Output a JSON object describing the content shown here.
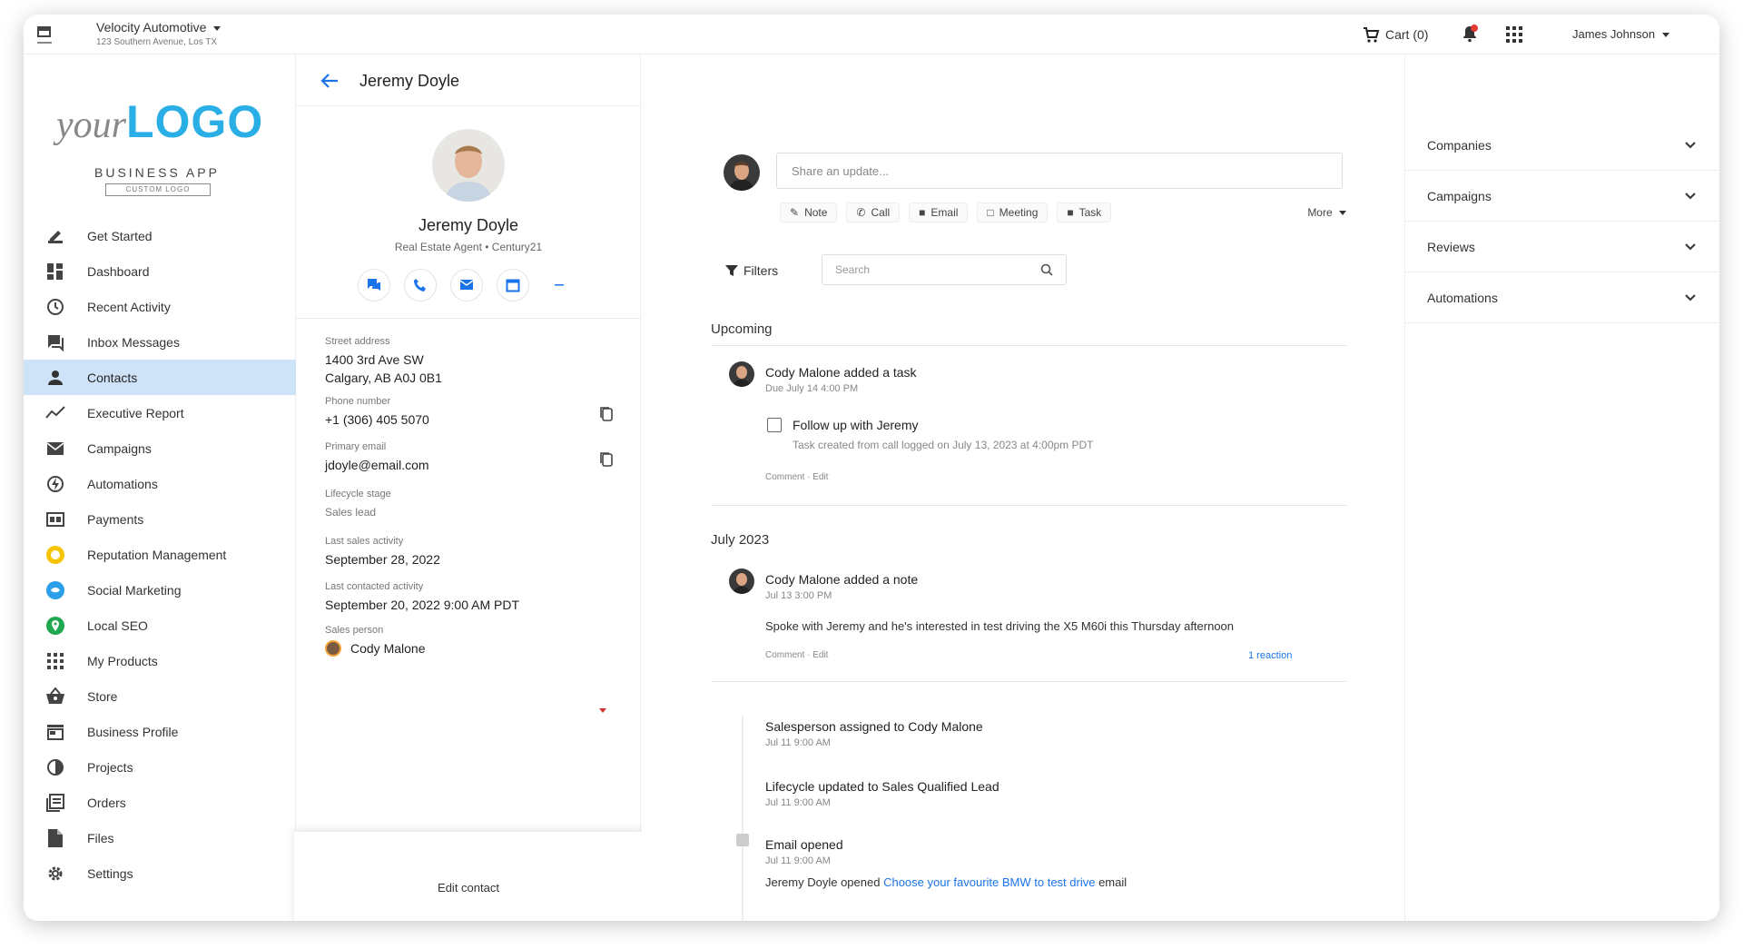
{
  "topbar": {
    "company_name": "Velocity Automotive",
    "company_address": "123 Southern Avenue, Los TX",
    "cart_label": "Cart (0)",
    "user_name": "James Johnson"
  },
  "sidebar": {
    "logo_your": "your",
    "logo_big": "LOGO",
    "business_app": "BUSINESS APP",
    "business_sub": "CUSTOM LOGO",
    "items": [
      {
        "label": "Get Started",
        "icon": "rocket-icon"
      },
      {
        "label": "Dashboard",
        "icon": "dashboard-icon"
      },
      {
        "label": "Recent Activity",
        "icon": "clock-icon"
      },
      {
        "label": "Inbox Messages",
        "icon": "chat-icon"
      },
      {
        "label": "Contacts",
        "icon": "person-icon"
      },
      {
        "label": "Executive Report",
        "icon": "trend-icon"
      },
      {
        "label": "Campaigns",
        "icon": "mail-icon"
      },
      {
        "label": "Automations",
        "icon": "automation-icon"
      },
      {
        "label": "Payments",
        "icon": "payment-icon"
      },
      {
        "label": "Reputation Management",
        "icon": "star-circle-icon"
      },
      {
        "label": "Social Marketing",
        "icon": "social-icon"
      },
      {
        "label": "Local SEO",
        "icon": "pin-icon"
      },
      {
        "label": "My Products",
        "icon": "grid-icon"
      },
      {
        "label": "Store",
        "icon": "basket-icon"
      },
      {
        "label": "Business Profile",
        "icon": "storefront-icon"
      },
      {
        "label": "Projects",
        "icon": "projects-icon"
      },
      {
        "label": "Orders",
        "icon": "orders-icon"
      },
      {
        "label": "Files",
        "icon": "file-icon"
      },
      {
        "label": "Settings",
        "icon": "gear-icon"
      }
    ]
  },
  "contact": {
    "header_name": "Jeremy Doyle",
    "name": "Jeremy Doyle",
    "subtitle": "Real Estate Agent • Century21",
    "fields": {
      "address_label": "Street address",
      "address_line1": "1400 3rd Ave SW",
      "address_line2": "Calgary, AB A0J 0B1",
      "phone_label": "Phone number",
      "phone_value": "+1 (306) 405 5070",
      "email_label": "Primary email",
      "email_value": "jdoyle@email.com",
      "lifecycle_label": "Lifecycle stage",
      "lifecycle_value": "Sales lead",
      "last_activity_label": "Last sales activity",
      "last_activity_value": "September 28, 2022",
      "last_contacted_label": "Last contacted activity",
      "last_contacted_value": "September 20, 2022 9:00 AM PDT",
      "owner_label": "Sales person",
      "owner_value": "Cody Malone"
    },
    "footer_button": "Edit contact"
  },
  "activity": {
    "post_placeholder": "Share an update...",
    "actions": [
      "Note",
      "Call",
      "Email",
      "Meeting",
      "Task"
    ],
    "more_label": "More",
    "filters_label": "Filters",
    "search_placeholder": "Search",
    "upcoming_title": "Upcoming",
    "task_title": "Cody Malone added a task",
    "task_sub": "Due July 14 4:00 PM",
    "task_item": "Follow up with Jeremy",
    "task_desc": "Task created from call logged on July 13, 2023 at 4:00pm PDT",
    "task_comment": "Comment · Edit",
    "month_title": "July 2023",
    "note_title": "Cody Malone added a note",
    "note_sub": "Jul 13 3:00 PM",
    "note_body": "Spoke with Jeremy and he's interested in test driving the X5 M60i this Thursday afternoon",
    "note_comment": "Comment · Edit",
    "note_link": "1 reaction",
    "events": [
      {
        "title": "Salesperson assigned to Cody Malone",
        "sub": "Jul 11 9:00 AM"
      },
      {
        "title": "Lifecycle updated to Sales Qualified Lead",
        "sub": "Jul 11 9:00 AM"
      },
      {
        "title": "Email opened",
        "sub": "Jul 11 9:00 AM",
        "body_prefix": "Jeremy Doyle opened ",
        "body_link": "Choose your favourite BMW to test drive",
        "body_suffix": " email"
      }
    ]
  },
  "right_panel": {
    "items": [
      "Companies",
      "Campaigns",
      "Reviews",
      "Automations"
    ]
  }
}
